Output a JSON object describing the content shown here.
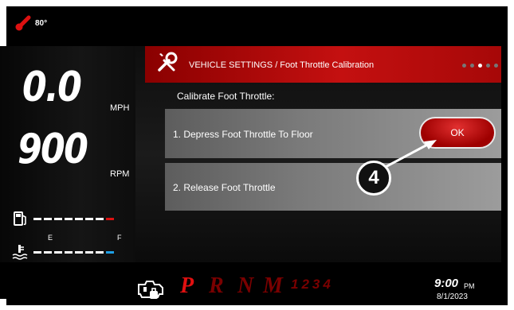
{
  "status": {
    "temperature": "80°"
  },
  "gauges": {
    "speed_value": "0.0",
    "speed_unit": "MPH",
    "rpm_value": "900",
    "rpm_unit": "RPM",
    "fuel_empty_label": "E",
    "fuel_full_label": "F"
  },
  "dialog": {
    "title": "VEHICLE SETTINGS / Foot Throttle Calibration",
    "heading": "Calibrate Foot Throttle:",
    "step1": "1. Depress Foot Throttle To Floor",
    "step2": "2. Release Foot Throttle",
    "ok_label": "OK"
  },
  "callout": {
    "label": "4"
  },
  "gear_selector": {
    "gears": [
      "P",
      "R",
      "N",
      "M"
    ],
    "manual_gears": "1234",
    "active_gear": "P"
  },
  "clock": {
    "time": "9:00",
    "ampm": "PM",
    "date": "8/1/2023"
  },
  "colors": {
    "accent_red": "#c41010",
    "coolant_blue": "#1ea0e6",
    "background": "#000000"
  },
  "icons": [
    "thermometer-icon",
    "fuel-icon",
    "coolant-icon",
    "wrench-screwdriver-icon",
    "engine-warning-icon"
  ]
}
